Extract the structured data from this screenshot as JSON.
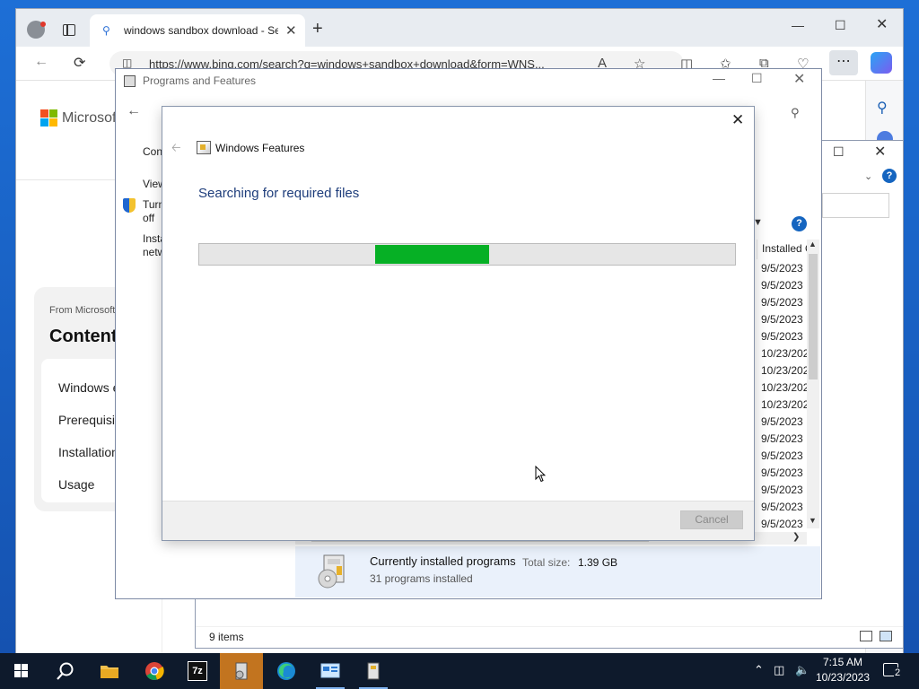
{
  "browser": {
    "tab_title": "windows sandbox download - Se",
    "tab_search_icon": "search-icon",
    "url": "https://www.bing.com/search?q=windows+sandbox+download&form=WNS..."
  },
  "bing": {
    "logo_text": "Microsoft",
    "card": {
      "from": "From Microsoft",
      "title": "Content",
      "items": [
        "Windows e",
        "Prerequisit",
        "Installation",
        "Usage"
      ]
    }
  },
  "background_window": {
    "status": "9 items"
  },
  "programs": {
    "title": "Programs and Features",
    "left_links": [
      "Con",
      "View",
      "Turn",
      "off",
      "Insta",
      "netw"
    ],
    "column_header": "Installed O",
    "dates": [
      "9/5/2023",
      "9/5/2023",
      "9/5/2023",
      "9/5/2023",
      "9/5/2023",
      "10/23/2023",
      "10/23/2023",
      "10/23/2023",
      "10/23/2023",
      "9/5/2023",
      "9/5/2023",
      "9/5/2023",
      "9/5/2023",
      "9/5/2023",
      "9/5/2023",
      "9/5/2023"
    ],
    "details": {
      "title": "Currently installed programs",
      "size_label": "Total size:",
      "size": "1.39 GB",
      "count": "31 programs installed"
    }
  },
  "features_dialog": {
    "title": "Windows Features",
    "heading": "Searching for required files",
    "progress": {
      "start": 0.329,
      "end": 0.541
    },
    "cancel_label": "Cancel"
  },
  "taskbar": {
    "apps": [
      "file-explorer",
      "chrome",
      "7-zip",
      "programs-and-features",
      "edge",
      "control-panel",
      "windows-features"
    ],
    "seven_zip_label": "7z",
    "time": "7:15 AM",
    "date": "10/23/2023",
    "notification_count": "2"
  },
  "colors": {
    "progress_fill": "#06b025",
    "heading_blue": "#1e3d7b",
    "taskbar_bg": "#0e1a2c",
    "active_app": "#c2741f"
  }
}
